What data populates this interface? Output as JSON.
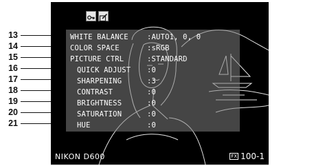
{
  "callouts": [
    "13",
    "14",
    "15",
    "16",
    "17",
    "18",
    "19",
    "20",
    "21"
  ],
  "screen": {
    "icons": [
      "protect-key-icon",
      "retouch-icon"
    ],
    "rows": [
      {
        "label": "WHITE BALANCE",
        "value": ":AUTO1, 0, 0"
      },
      {
        "label": "COLOR SPACE",
        "value": ":sRGB"
      },
      {
        "label": "PICTURE CTRL",
        "value": ":STANDARD"
      },
      {
        "label": "QUICK ADJUST",
        "value": ":0"
      },
      {
        "label": "SHARPENING",
        "value": ":3"
      },
      {
        "label": "CONTRAST",
        "value": ":0"
      },
      {
        "label": "BRIGHTNESS",
        "value": ":0"
      },
      {
        "label": "SATURATION",
        "value": ":0"
      },
      {
        "label": "HUE",
        "value": ":0"
      }
    ],
    "camera_model": "NIKON D600",
    "format_badge": "FX",
    "frame_number": "100-1"
  }
}
